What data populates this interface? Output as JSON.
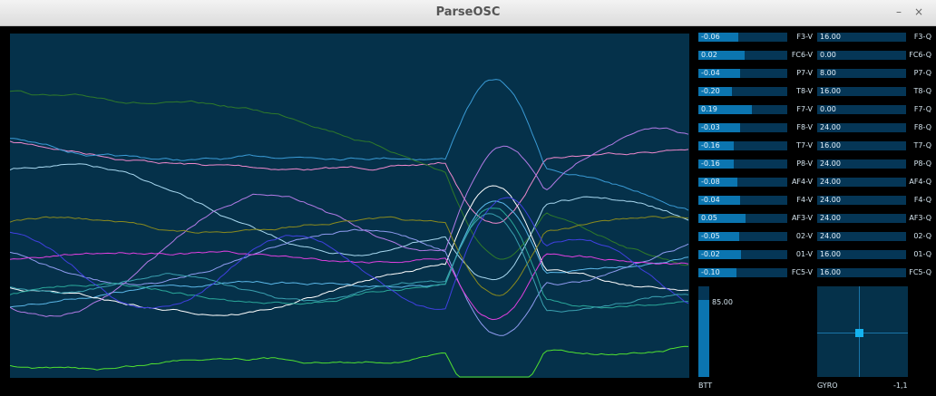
{
  "window": {
    "title": "ParseOSC",
    "minimize_symbol": "–",
    "close_symbol": "×"
  },
  "channels": [
    {
      "v_label": "F3-V",
      "v_value": "-0.06",
      "v_level": 0.45,
      "q_label": "F3-Q",
      "q_value": "16.00"
    },
    {
      "v_label": "FC6-V",
      "v_value": "0.02",
      "v_level": 0.52,
      "q_label": "FC6-Q",
      "q_value": "0.00"
    },
    {
      "v_label": "P7-V",
      "v_value": "-0.04",
      "v_level": 0.47,
      "q_label": "P7-Q",
      "q_value": "8.00"
    },
    {
      "v_label": "T8-V",
      "v_value": "-0.20",
      "v_level": 0.38,
      "q_label": "T8-Q",
      "q_value": "16.00"
    },
    {
      "v_label": "F7-V",
      "v_value": "0.19",
      "v_level": 0.6,
      "q_label": "F7-Q",
      "q_value": "0.00"
    },
    {
      "v_label": "F8-V",
      "v_value": "-0.03",
      "v_level": 0.47,
      "q_label": "F8-Q",
      "q_value": "24.00"
    },
    {
      "v_label": "T7-V",
      "v_value": "-0.16",
      "v_level": 0.4,
      "q_label": "T7-Q",
      "q_value": "16.00"
    },
    {
      "v_label": "P8-V",
      "v_value": "-0.16",
      "v_level": 0.4,
      "q_label": "P8-Q",
      "q_value": "24.00"
    },
    {
      "v_label": "AF4-V",
      "v_value": "-0.08",
      "v_level": 0.44,
      "q_label": "AF4-Q",
      "q_value": "24.00"
    },
    {
      "v_label": "F4-V",
      "v_value": "-0.04",
      "v_level": 0.47,
      "q_label": "F4-Q",
      "q_value": "24.00"
    },
    {
      "v_label": "AF3-V",
      "v_value": "0.05",
      "v_level": 0.53,
      "q_label": "AF3-Q",
      "q_value": "24.00"
    },
    {
      "v_label": "02-V",
      "v_value": "-0.05",
      "v_level": 0.46,
      "q_label": "02-Q",
      "q_value": "24.00"
    },
    {
      "v_label": "01-V",
      "v_value": "-0.02",
      "v_level": 0.48,
      "q_label": "01-Q",
      "q_value": "16.00"
    },
    {
      "v_label": "FC5-V",
      "v_value": "-0.10",
      "v_level": 0.43,
      "q_label": "FC5-Q",
      "q_value": "16.00"
    }
  ],
  "battery": {
    "label": "BTT",
    "value": "85.00",
    "level": 0.85
  },
  "gyro": {
    "label": "GYRO",
    "value": "-1,1"
  },
  "colors": {
    "plot_bg": "#05314a",
    "bar_bg": "#053656",
    "bar_fill": "#0b75b0",
    "traces": [
      "#ee88cc",
      "#3a9bd6",
      "#2f7a2a",
      "#5bb7e8",
      "#a8d8f0",
      "#ffffff",
      "#8f9cf0",
      "#b27be6",
      "#e040e0",
      "#2aa79a",
      "#8a8a1e",
      "#4040e0",
      "#50e030",
      "#3aa0b0"
    ]
  }
}
